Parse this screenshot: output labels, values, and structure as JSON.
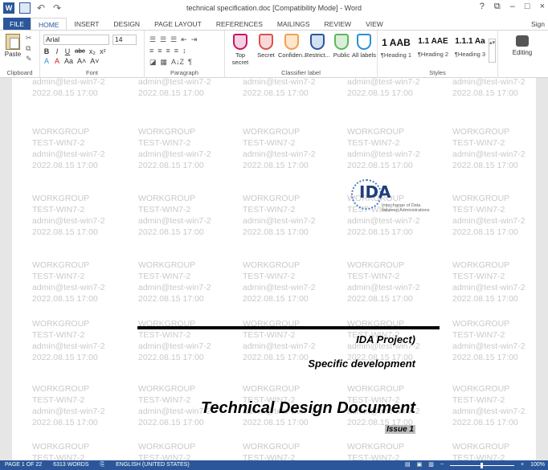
{
  "window": {
    "title": "technical specification.doc [Compatibility Mode] - Word",
    "help": "?",
    "restore": "⧉",
    "minimize": "–",
    "maximize": "□",
    "close": "×",
    "signin": "Sign"
  },
  "tabs": [
    {
      "label": "FILE"
    },
    {
      "label": "HOME"
    },
    {
      "label": "INSERT"
    },
    {
      "label": "DESIGN"
    },
    {
      "label": "PAGE LAYOUT"
    },
    {
      "label": "REFERENCES"
    },
    {
      "label": "MAILINGS"
    },
    {
      "label": "REVIEW"
    },
    {
      "label": "VIEW"
    }
  ],
  "ribbon": {
    "clipboard": {
      "paste": "Paste",
      "label": "Clipboard"
    },
    "font": {
      "name": "Arial",
      "size": "14",
      "label": "Font",
      "bold": "B",
      "italic": "I",
      "underline": "U",
      "strike": "abc",
      "sub": "x₂",
      "sup": "x²",
      "clear": "A",
      "grow": "A˄",
      "shrink": "A˅",
      "case": "Aa"
    },
    "paragraph": {
      "label": "Paragraph",
      "sort": "A↓Z",
      "pilcrow": "¶"
    },
    "classifier": {
      "label": "Classifier label",
      "buttons": [
        {
          "label": "Top secret",
          "color": "#c2186a"
        },
        {
          "label": "Secret",
          "color": "#d9534f"
        },
        {
          "label": "Confiden...",
          "color": "#f0a050"
        },
        {
          "label": "Restrict...",
          "color": "#2b579a"
        },
        {
          "label": "Public",
          "color": "#5cb85c"
        },
        {
          "label": "All labels",
          "color": "#2b8fd9"
        }
      ]
    },
    "styles": {
      "label": "Styles",
      "items": [
        {
          "sample": "1 AAB",
          "name": "¶Heading 1"
        },
        {
          "sample": "1.1 AAE",
          "name": "¶Heading 2"
        },
        {
          "sample": "1.1.1 Aa",
          "name": "¶Heading 3"
        }
      ]
    },
    "editing": {
      "label": "Editing"
    }
  },
  "watermark": {
    "lines": [
      "WORKGROUP",
      "TEST-WIN7-2",
      "admin@test-win7-2",
      "2022.08.15 17:00"
    ]
  },
  "logo": {
    "text": "IDA",
    "subtitle": "Interchange of Data between Administrations"
  },
  "document": {
    "project": "IDA Project)",
    "development": "Specific development",
    "heading": "Technical Design Document",
    "issue": "Issue 1"
  },
  "status": {
    "page": "PAGE 1 OF 22",
    "words": "6313 WORDS",
    "language": "ENGLISH (UNITED STATES)",
    "zoom": "100%"
  },
  "colors": {
    "accent": "#2b579a",
    "watermark": "#c9c9c9"
  }
}
